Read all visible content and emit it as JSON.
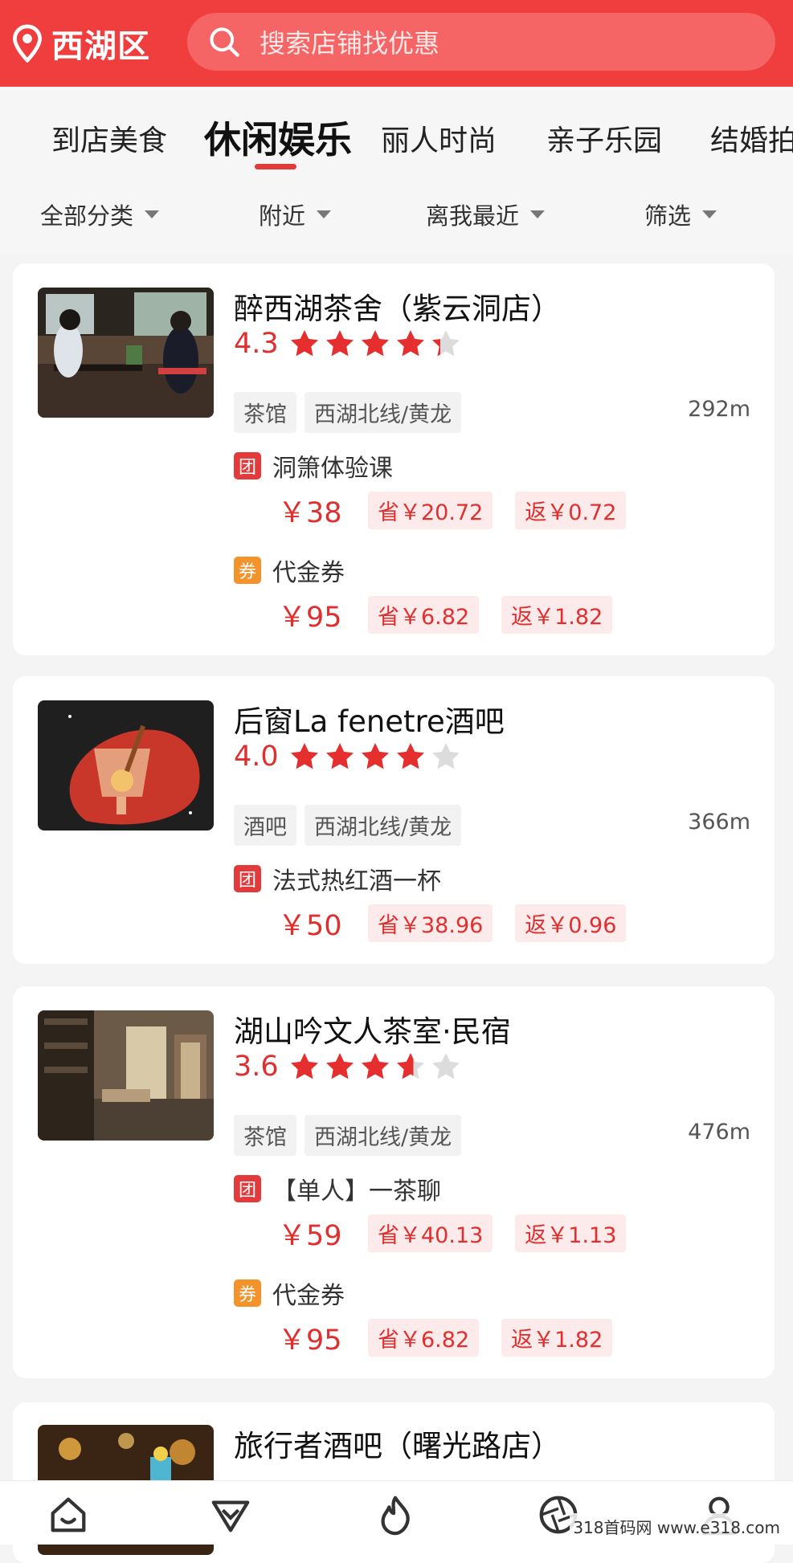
{
  "header": {
    "location": "西湖区",
    "search_placeholder": "搜索店铺找优惠",
    "accent_color": "#f03e3e"
  },
  "tabs": [
    {
      "label": "到店美食",
      "active": false
    },
    {
      "label": "休闲娱乐",
      "active": true
    },
    {
      "label": "丽人时尚",
      "active": false
    },
    {
      "label": "亲子乐园",
      "active": false
    },
    {
      "label": "结婚拍",
      "active": false
    }
  ],
  "filters": [
    {
      "label": "全部分类"
    },
    {
      "label": "附近"
    },
    {
      "label": "离我最近"
    },
    {
      "label": "筛选"
    }
  ],
  "shops": [
    {
      "name": "醉西湖茶舍（紫云洞店）",
      "rating": "4.3",
      "rating_value": 4.3,
      "tags": [
        "茶馆",
        "西湖北线/黄龙"
      ],
      "distance": "292m",
      "deals": [
        {
          "badge": "团",
          "type": "tuan",
          "title": "洞箫体验课",
          "price": "￥38",
          "save": "省￥20.72",
          "rebate": "返￥0.72"
        },
        {
          "badge": "券",
          "type": "quan",
          "title": "代金券",
          "price": "￥95",
          "save": "省￥6.82",
          "rebate": "返￥1.82"
        }
      ]
    },
    {
      "name": "后窗La fenetre酒吧",
      "rating": "4.0",
      "rating_value": 4.0,
      "tags": [
        "酒吧",
        "西湖北线/黄龙"
      ],
      "distance": "366m",
      "deals": [
        {
          "badge": "团",
          "type": "tuan",
          "title": "法式热红酒一杯",
          "price": "￥50",
          "save": "省￥38.96",
          "rebate": "返￥0.96"
        }
      ]
    },
    {
      "name": "湖山吟文人茶室·民宿",
      "rating": "3.6",
      "rating_value": 3.6,
      "tags": [
        "茶馆",
        "西湖北线/黄龙"
      ],
      "distance": "476m",
      "deals": [
        {
          "badge": "团",
          "type": "tuan",
          "title": "【单人】一茶聊",
          "price": "￥59",
          "save": "省￥40.13",
          "rebate": "返￥1.13"
        },
        {
          "badge": "券",
          "type": "quan",
          "title": "代金券",
          "price": "￥95",
          "save": "省￥6.82",
          "rebate": "返￥1.82"
        }
      ]
    },
    {
      "name": "旅行者酒吧（曙光路店）"
    }
  ],
  "bottom_nav": [
    "home-icon",
    "discover-icon",
    "flame-icon",
    "camera-shutter-icon",
    "profile-icon"
  ],
  "watermark": "318首码网  www.e318.com"
}
